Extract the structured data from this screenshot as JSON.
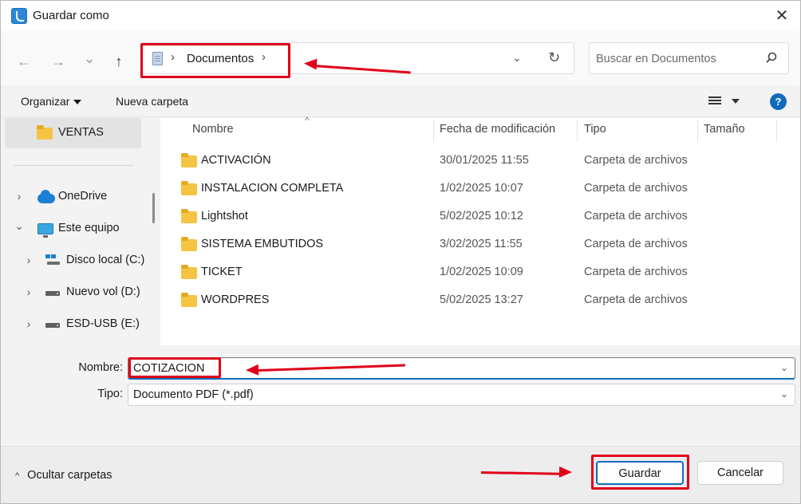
{
  "window": {
    "title": "Guardar como",
    "close_glyph": "✕",
    "app_icon": "save-dialog-icon"
  },
  "nav": {
    "back_glyph": "←",
    "forward_glyph": "→",
    "recent_glyph": "⌄",
    "up_glyph": "↑",
    "breadcrumb": [
      "Documentos"
    ],
    "breadcrumb_separator": "›",
    "dropdown_glyph": "⌄",
    "refresh_glyph": "↻",
    "search_placeholder": "Buscar en Documentos"
  },
  "toolbar": {
    "organize_label": "Organizar",
    "new_folder_label": "Nueva carpeta",
    "help_label": "?"
  },
  "sidebar": {
    "items": [
      {
        "label": "VENTAS",
        "icon": "folder-icon",
        "chevron": ""
      },
      {
        "label": "OneDrive",
        "icon": "onedrive-icon",
        "chevron": "›"
      },
      {
        "label": "Este equipo",
        "icon": "computer-icon",
        "chevron": "⌄"
      },
      {
        "label": "Disco local (C:)",
        "icon": "windows-drive-icon",
        "chevron": "›"
      },
      {
        "label": "Nuevo vol (D:)",
        "icon": "drive-icon",
        "chevron": "›"
      },
      {
        "label": "ESD-USB (E:)",
        "icon": "drive-icon",
        "chevron": "›"
      }
    ]
  },
  "filelist": {
    "columns": [
      "Nombre",
      "Fecha de modificación",
      "Tipo",
      "Tamaño"
    ],
    "sort_glyph": "^",
    "rows": [
      {
        "name": "ACTIVACIÓN",
        "date": "30/01/2025 11:55",
        "type": "Carpeta de archivos",
        "size": ""
      },
      {
        "name": "INSTALACION COMPLETA",
        "date": "1/02/2025 10:07",
        "type": "Carpeta de archivos",
        "size": ""
      },
      {
        "name": "Lightshot",
        "date": "5/02/2025 10:12",
        "type": "Carpeta de archivos",
        "size": ""
      },
      {
        "name": "SISTEMA EMBUTIDOS",
        "date": "3/02/2025 11:55",
        "type": "Carpeta de archivos",
        "size": ""
      },
      {
        "name": "TICKET",
        "date": "1/02/2025 10:09",
        "type": "Carpeta de archivos",
        "size": ""
      },
      {
        "name": "WORDPRES",
        "date": "5/02/2025 13:27",
        "type": "Carpeta de archivos",
        "size": ""
      }
    ]
  },
  "form": {
    "name_label": "Nombre:",
    "name_value": "COTIZACION",
    "type_label": "Tipo:",
    "type_value": "Documento PDF (*.pdf)",
    "chevron_glyph": "⌄"
  },
  "footer": {
    "hide_folders_glyph": "^",
    "hide_folders_label": "Ocultar carpetas",
    "save_label": "Guardar",
    "cancel_label": "Cancelar"
  },
  "colors": {
    "annotation_red": "#e0001a",
    "accent_blue": "#0f6cbd",
    "folder_yellow": "#f6c445"
  }
}
